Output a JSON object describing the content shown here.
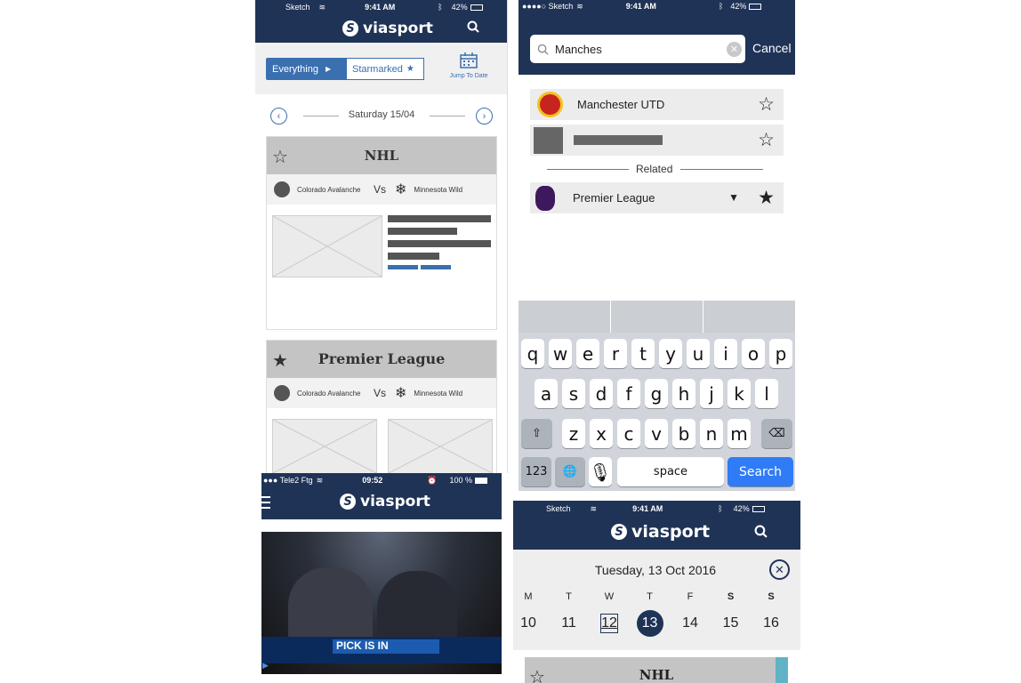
{
  "p1": {
    "status": {
      "carrier": "Sketch",
      "time": "9:41 AM",
      "battery": "42%"
    },
    "brand": "viasport",
    "filter": {
      "everything": "Everything",
      "starmarked": "Starmarked",
      "jump": "Jump To Date"
    },
    "date": "Saturday 15/04",
    "card1": {
      "league": "NHL",
      "home": "Colorado Avalanche",
      "vs": "Vs",
      "away": "Minnesota Wild"
    },
    "card2": {
      "league": "Premier League",
      "home": "Colorado Avalanche",
      "vs": "Vs",
      "away": "Minnesota Wild"
    }
  },
  "p2": {
    "status": {
      "carrier": "●●●●○ Sketch",
      "time": "9:41 AM",
      "battery": "42%"
    },
    "search": {
      "value": "Manches",
      "cancel": "Cancel"
    },
    "results": [
      {
        "name": "Manchester UTD"
      }
    ],
    "related_label": "Related",
    "related": {
      "name": "Premier League"
    },
    "keyboard": {
      "row1": [
        "q",
        "w",
        "e",
        "r",
        "t",
        "y",
        "u",
        "i",
        "o",
        "p"
      ],
      "row2": [
        "a",
        "s",
        "d",
        "f",
        "g",
        "h",
        "j",
        "k",
        "l"
      ],
      "row3": [
        "z",
        "x",
        "c",
        "v",
        "b",
        "n",
        "m"
      ],
      "numkey": "123",
      "space": "space",
      "search": "Search"
    }
  },
  "p3": {
    "status": {
      "carrier": "●●● Tele2 Ftg",
      "time": "09:52",
      "battery": "100 %"
    },
    "brand": "viasport",
    "video": {
      "banner": "PICK IS IN"
    }
  },
  "p4": {
    "status": {
      "carrier": "Sketch",
      "time": "9:41 AM",
      "battery": "42%"
    },
    "brand": "viasport",
    "date": "Tuesday, 13 Oct 2016",
    "weekdays": [
      "M",
      "T",
      "W",
      "T",
      "F",
      "S",
      "S"
    ],
    "days": [
      "10",
      "11",
      "12",
      "13",
      "14",
      "15",
      "16"
    ],
    "card_league": "NHL"
  },
  "colors": {
    "navy": "#1f3356",
    "blue": "#3a6fb0",
    "search_blue": "#2f7cf6"
  }
}
